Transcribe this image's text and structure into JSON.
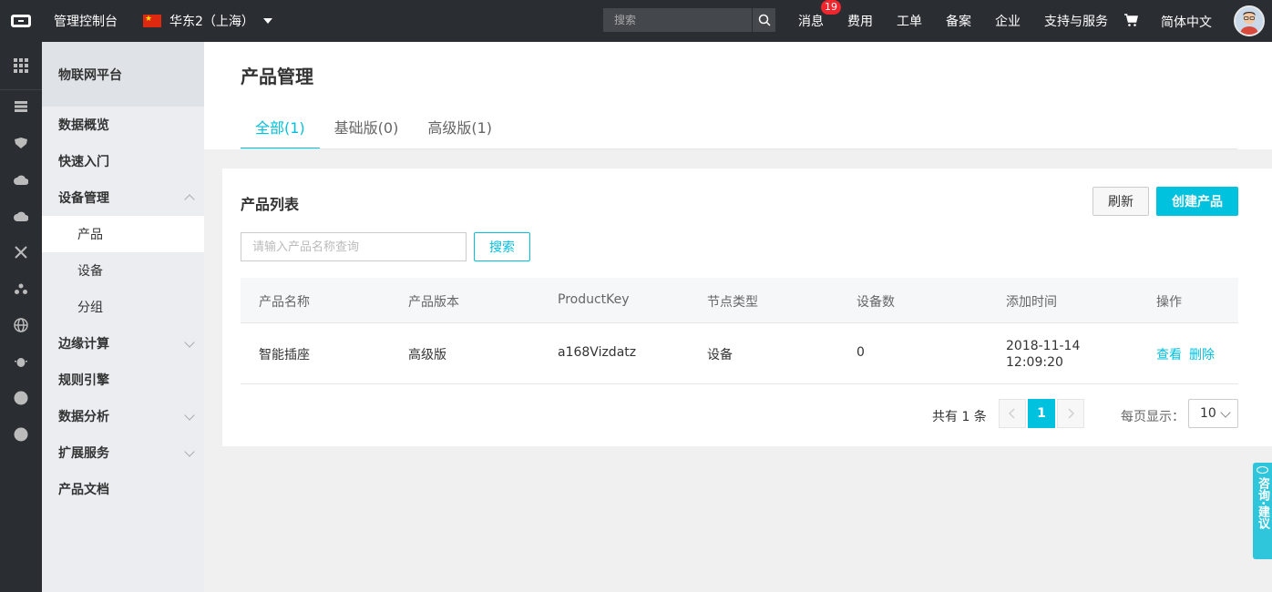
{
  "topbar": {
    "console_title": "管理控制台",
    "region": "华东2（上海）",
    "search_placeholder": "搜索",
    "nav": [
      {
        "label": "消息",
        "badge": "19"
      },
      {
        "label": "费用"
      },
      {
        "label": "工单"
      },
      {
        "label": "备案"
      },
      {
        "label": "企业"
      },
      {
        "label": "支持与服务"
      }
    ],
    "lang": "简体中文"
  },
  "sidebar": {
    "title": "物联网平台",
    "items": [
      {
        "label": "数据概览"
      },
      {
        "label": "快速入门"
      },
      {
        "label": "设备管理"
      },
      {
        "label": "产品"
      },
      {
        "label": "设备"
      },
      {
        "label": "分组"
      },
      {
        "label": "边缘计算"
      },
      {
        "label": "规则引擎"
      },
      {
        "label": "数据分析"
      },
      {
        "label": "扩展服务"
      },
      {
        "label": "产品文档"
      }
    ]
  },
  "main": {
    "title": "产品管理",
    "tabs": [
      {
        "label": "全部(1)"
      },
      {
        "label": "基础版(0)"
      },
      {
        "label": "高级版(1)"
      }
    ],
    "card": {
      "title": "产品列表",
      "refresh_label": "刷新",
      "create_label": "创建产品",
      "search_placeholder": "请输入产品名称查询",
      "search_label": "搜索",
      "columns": [
        "产品名称",
        "产品版本",
        "ProductKey",
        "节点类型",
        "设备数",
        "添加时间",
        "操作"
      ],
      "rows": [
        {
          "name": "智能插座",
          "version": "高级版",
          "product_key": "a168Vizdatz",
          "node_type": "设备",
          "device_count": "0",
          "added_date": "2018-11-14",
          "added_time": "12:09:20",
          "view_label": "查看",
          "delete_label": "删除"
        }
      ],
      "pagination": {
        "total_text": "共有 1 条",
        "current_page": "1",
        "per_page_label": "每页显示：",
        "per_page_value": "10"
      }
    }
  },
  "float_tab": {
    "label": "咨询·建议"
  }
}
